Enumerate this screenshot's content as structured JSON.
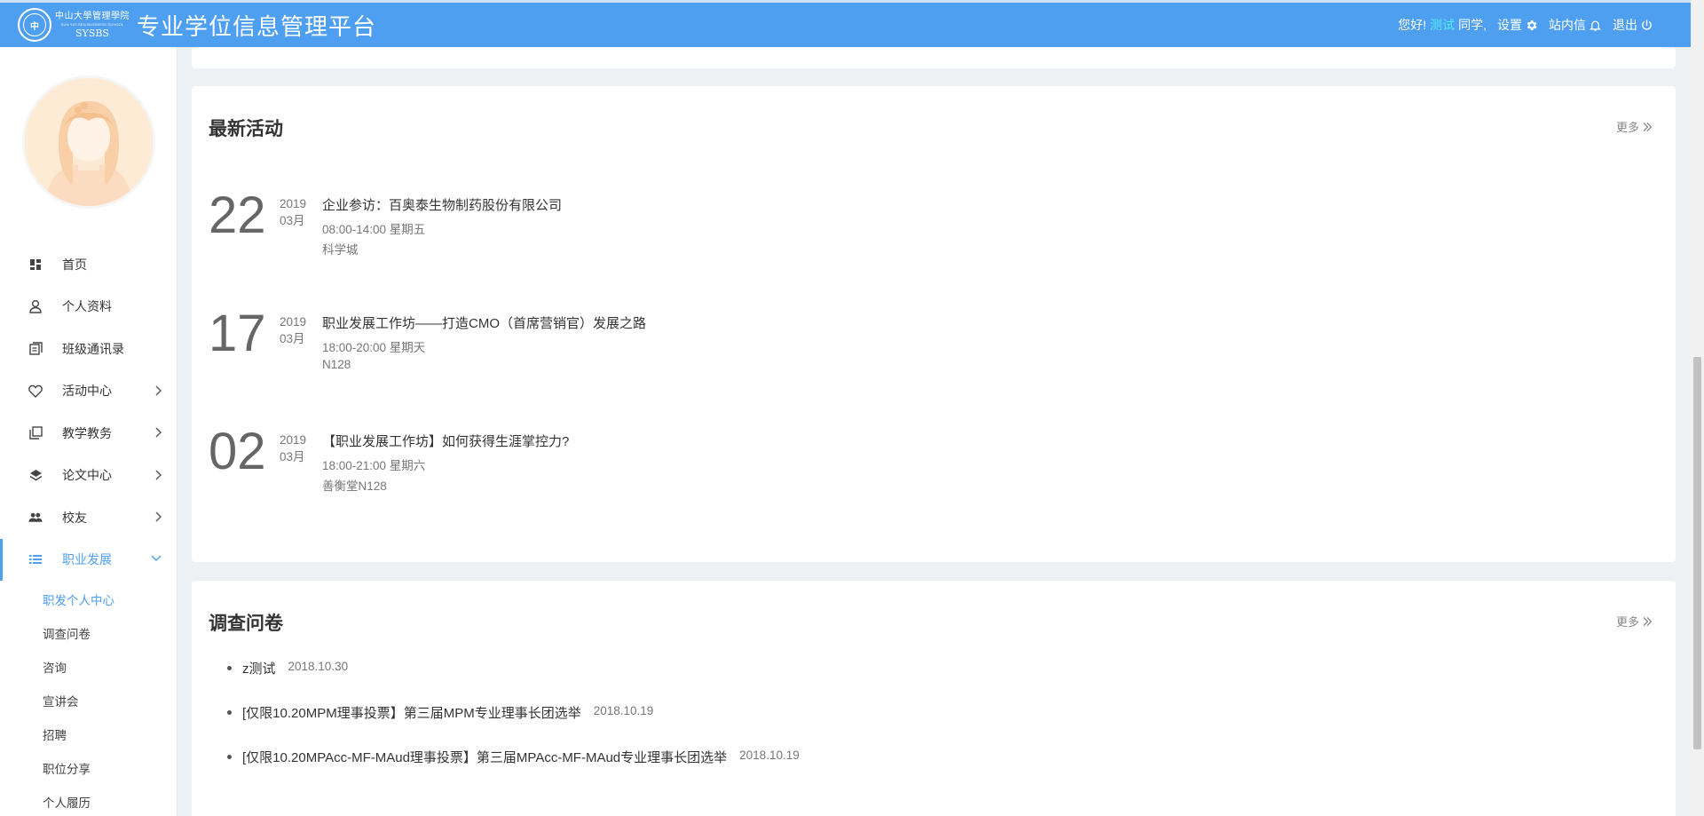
{
  "header": {
    "logo_cn": "中山大學管理學院",
    "logo_en_small": "SUN YAT-SEN BUSINESS SCHOOL",
    "logo_en": "SYSBS",
    "app_title": "专业学位信息管理平台",
    "greeting": "您好!",
    "username": "测试",
    "greeting_suffix": "同学,",
    "settings_label": "设置",
    "messages_label": "站内信",
    "logout_label": "退出",
    "accent": "#4e9ff0",
    "username_color": "#4ff0ff"
  },
  "sidebar": {
    "items": [
      {
        "label": "首页",
        "icon": "dashboard-icon"
      },
      {
        "label": "个人资料",
        "icon": "user-icon"
      },
      {
        "label": "班级通讯录",
        "icon": "book-icon"
      },
      {
        "label": "活动中心",
        "icon": "heart-icon"
      },
      {
        "label": "教学教务",
        "icon": "copy-icon"
      },
      {
        "label": "论文中心",
        "icon": "layers-icon"
      },
      {
        "label": "校友",
        "icon": "users-icon"
      },
      {
        "label": "职业发展",
        "icon": "list-icon"
      }
    ],
    "submenu": [
      "职发个人中心",
      "调查问卷",
      "咨询",
      "宣讲会",
      "招聘",
      "职位分享",
      "个人履历"
    ]
  },
  "activities": {
    "title": "最新活动",
    "more": "更多",
    "items": [
      {
        "day": "22",
        "year": "2019",
        "month": "03月",
        "title": "企业参访：百奥泰生物制药股份有限公司",
        "time": "08:00-14:00 星期五",
        "place": "科学城"
      },
      {
        "day": "17",
        "year": "2019",
        "month": "03月",
        "title": "职业发展工作坊——打造CMO（首席营销官）发展之路",
        "time": "18:00-20:00 星期天",
        "place": "N128"
      },
      {
        "day": "02",
        "year": "2019",
        "month": "03月",
        "title": "【职业发展工作坊】如何获得生涯掌控力?",
        "time": "18:00-21:00 星期六",
        "place": "善衡堂N128"
      }
    ]
  },
  "survey": {
    "title": "调查问卷",
    "more": "更多",
    "items": [
      {
        "title": "z测试",
        "date": "2018.10.30"
      },
      {
        "title": "[仅限10.20MPM理事投票】第三届MPM专业理事长团选举",
        "date": "2018.10.19"
      },
      {
        "title": "[仅限10.20MPAcc-MF-MAud理事投票】第三届MPAcc-MF-MAud专业理事长团选举",
        "date": "2018.10.19"
      }
    ]
  }
}
